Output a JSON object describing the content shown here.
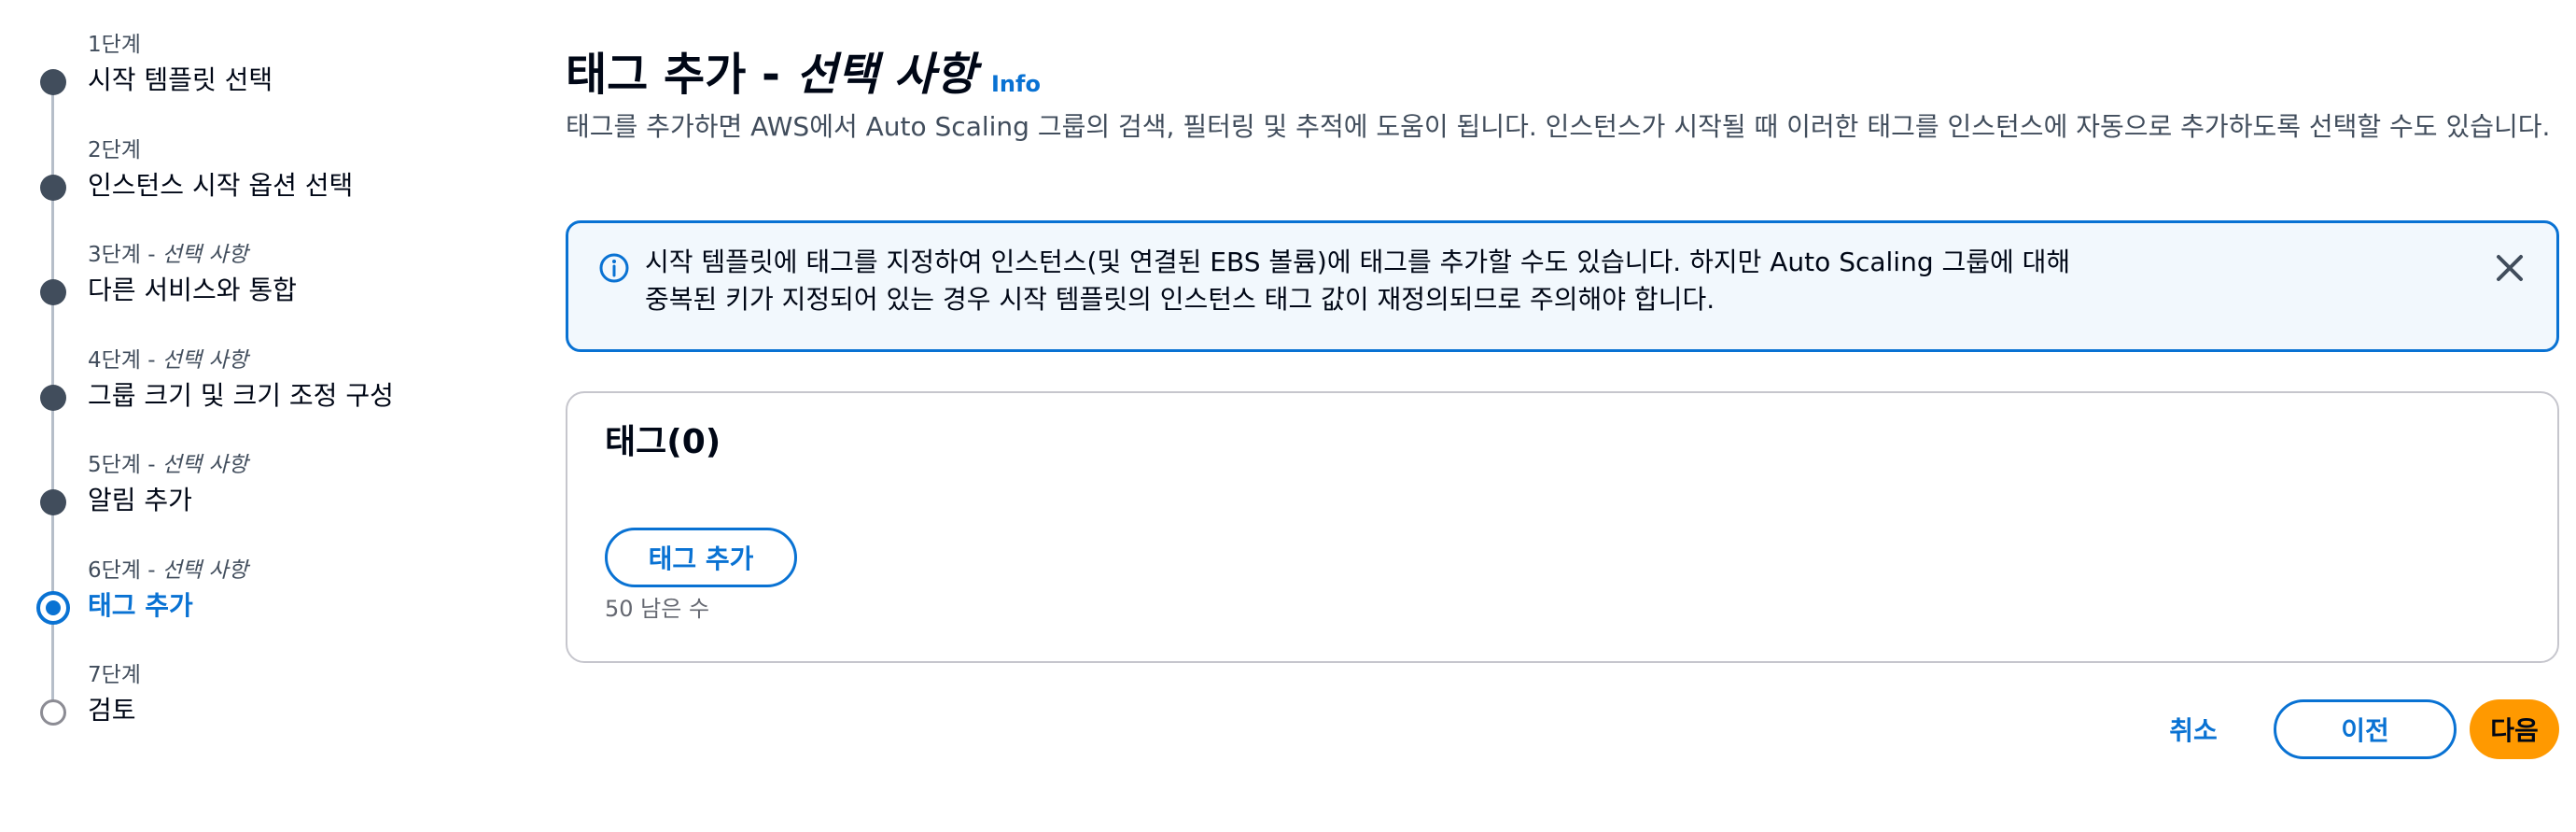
{
  "steps": [
    {
      "num": "1단계",
      "optional": "",
      "title": "시작 템플릿 선택",
      "state": "done"
    },
    {
      "num": "2단계",
      "optional": "",
      "title": "인스턴스 시작 옵션 선택",
      "state": "done"
    },
    {
      "num": "3단계 - ",
      "optional": "선택 사항",
      "title": "다른 서비스와 통합",
      "state": "done"
    },
    {
      "num": "4단계 - ",
      "optional": "선택 사항",
      "title": "그룹 크기 및 크기 조정 구성",
      "state": "done"
    },
    {
      "num": "5단계 - ",
      "optional": "선택 사항",
      "title": "알림 추가",
      "state": "done"
    },
    {
      "num": "6단계 - ",
      "optional": "선택 사항",
      "title": "태그 추가",
      "state": "active"
    },
    {
      "num": "7단계",
      "optional": "",
      "title": "검토",
      "state": "future"
    }
  ],
  "header": {
    "title": "태그 추가 - ",
    "title_optional": "선택 사항",
    "info": "Info",
    "description": "태그를 추가하면 AWS에서 Auto Scaling 그룹의 검색, 필터링 및 추적에 도움이 됩니다. 인스턴스가 시작될 때 이러한 태그를 인스턴스에 자동으로 추가하도록 선택할 수도 있습니다."
  },
  "alert": {
    "text": "시작 템플릿에 태그를 지정하여 인스턴스(및 연결된 EBS 볼륨)에 태그를 추가할 수도 있습니다. 하지만 Auto Scaling 그룹에 대해 중복된 키가 지정되어 있는 경우 시작 템플릿의 인스턴스 태그 값이 재정의되므로 주의해야 합니다."
  },
  "tags_panel": {
    "title": "태그(0)",
    "add_button": "태그 추가",
    "remaining": "50 남은 수"
  },
  "footer": {
    "cancel": "취소",
    "previous": "이전",
    "next": "다음"
  },
  "colors": {
    "accent": "#0972d3",
    "primary_button": "#ff9900",
    "alert_bg": "#f2f8fd",
    "step_dot": "#414d5c"
  }
}
